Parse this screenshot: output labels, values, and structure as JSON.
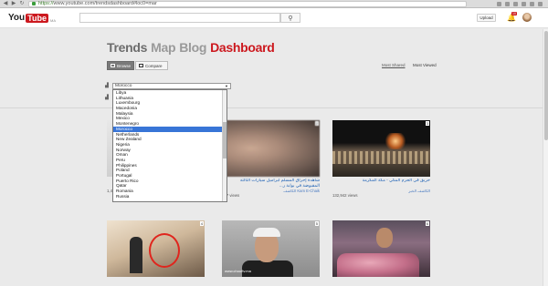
{
  "browser": {
    "url_secure": "https://",
    "url_rest": "www.youtube.com/trendsdashboard#loc0=mar"
  },
  "header": {
    "logo_you": "You",
    "logo_tube": "Tube",
    "logo_region": "MA",
    "search_placeholder": "",
    "upload_label": "Upload",
    "notification_count": "10"
  },
  "nav": {
    "trends": "Trends",
    "map": "Map",
    "blog": "Blog",
    "dashboard": "Dashboard"
  },
  "toggles": {
    "browse": "Browse",
    "compare": "Compare"
  },
  "sort": {
    "most_shared": "Most Shared",
    "most_viewed": "Most Viewed"
  },
  "location": {
    "selected": "Morocco",
    "options": [
      "Libya",
      "Lithuania",
      "Luxembourg",
      "Macedonia",
      "Malaysia",
      "Mexico",
      "Montenegro",
      "Morocco",
      "Netherlands",
      "New Zealand",
      "Nigeria",
      "Norway",
      "Oman",
      "Peru",
      "Philippines",
      "Poland",
      "Portugal",
      "Puerto Rico",
      "Qatar",
      "Romania",
      "Russia"
    ]
  },
  "videos": [
    {
      "num": "1",
      "title": "",
      "channel": "",
      "views": "1,45"
    },
    {
      "num": "2",
      "title": "شاهدة إحراق المسلم لبراميل سيارات الثالثة المقبوضة في بوابة ر...",
      "channel": "Kam E-Chaik الكاشف",
      "views": "387 views"
    },
    {
      "num": "3",
      "title": "حريق في الحرم المكي - مكة المكرمة",
      "channel": "الكاشف الخبر",
      "views": "132,942 views"
    },
    {
      "num": "4",
      "title": "",
      "channel": "",
      "views": ""
    },
    {
      "num": "5",
      "title": "",
      "channel": "",
      "views": ""
    },
    {
      "num": "6",
      "title": "",
      "channel": "",
      "views": ""
    }
  ],
  "thumb5_watermark": "www.chouftv.ma",
  "colors": {
    "brand_red": "#cc181e",
    "link_blue": "#1a5fb4",
    "select_highlight": "#3875d7"
  }
}
